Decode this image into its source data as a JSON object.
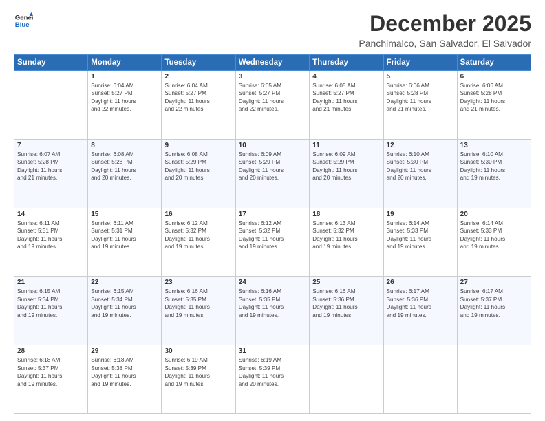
{
  "logo": {
    "line1": "General",
    "line2": "Blue"
  },
  "title": "December 2025",
  "subtitle": "Panchimalco, San Salvador, El Salvador",
  "weekdays": [
    "Sunday",
    "Monday",
    "Tuesday",
    "Wednesday",
    "Thursday",
    "Friday",
    "Saturday"
  ],
  "weeks": [
    [
      {
        "day": "",
        "info": ""
      },
      {
        "day": "1",
        "info": "Sunrise: 6:04 AM\nSunset: 5:27 PM\nDaylight: 11 hours\nand 22 minutes."
      },
      {
        "day": "2",
        "info": "Sunrise: 6:04 AM\nSunset: 5:27 PM\nDaylight: 11 hours\nand 22 minutes."
      },
      {
        "day": "3",
        "info": "Sunrise: 6:05 AM\nSunset: 5:27 PM\nDaylight: 11 hours\nand 22 minutes."
      },
      {
        "day": "4",
        "info": "Sunrise: 6:05 AM\nSunset: 5:27 PM\nDaylight: 11 hours\nand 21 minutes."
      },
      {
        "day": "5",
        "info": "Sunrise: 6:06 AM\nSunset: 5:28 PM\nDaylight: 11 hours\nand 21 minutes."
      },
      {
        "day": "6",
        "info": "Sunrise: 6:06 AM\nSunset: 5:28 PM\nDaylight: 11 hours\nand 21 minutes."
      }
    ],
    [
      {
        "day": "7",
        "info": "Sunrise: 6:07 AM\nSunset: 5:28 PM\nDaylight: 11 hours\nand 21 minutes."
      },
      {
        "day": "8",
        "info": "Sunrise: 6:08 AM\nSunset: 5:28 PM\nDaylight: 11 hours\nand 20 minutes."
      },
      {
        "day": "9",
        "info": "Sunrise: 6:08 AM\nSunset: 5:29 PM\nDaylight: 11 hours\nand 20 minutes."
      },
      {
        "day": "10",
        "info": "Sunrise: 6:09 AM\nSunset: 5:29 PM\nDaylight: 11 hours\nand 20 minutes."
      },
      {
        "day": "11",
        "info": "Sunrise: 6:09 AM\nSunset: 5:29 PM\nDaylight: 11 hours\nand 20 minutes."
      },
      {
        "day": "12",
        "info": "Sunrise: 6:10 AM\nSunset: 5:30 PM\nDaylight: 11 hours\nand 20 minutes."
      },
      {
        "day": "13",
        "info": "Sunrise: 6:10 AM\nSunset: 5:30 PM\nDaylight: 11 hours\nand 19 minutes."
      }
    ],
    [
      {
        "day": "14",
        "info": "Sunrise: 6:11 AM\nSunset: 5:31 PM\nDaylight: 11 hours\nand 19 minutes."
      },
      {
        "day": "15",
        "info": "Sunrise: 6:11 AM\nSunset: 5:31 PM\nDaylight: 11 hours\nand 19 minutes."
      },
      {
        "day": "16",
        "info": "Sunrise: 6:12 AM\nSunset: 5:32 PM\nDaylight: 11 hours\nand 19 minutes."
      },
      {
        "day": "17",
        "info": "Sunrise: 6:12 AM\nSunset: 5:32 PM\nDaylight: 11 hours\nand 19 minutes."
      },
      {
        "day": "18",
        "info": "Sunrise: 6:13 AM\nSunset: 5:32 PM\nDaylight: 11 hours\nand 19 minutes."
      },
      {
        "day": "19",
        "info": "Sunrise: 6:14 AM\nSunset: 5:33 PM\nDaylight: 11 hours\nand 19 minutes."
      },
      {
        "day": "20",
        "info": "Sunrise: 6:14 AM\nSunset: 5:33 PM\nDaylight: 11 hours\nand 19 minutes."
      }
    ],
    [
      {
        "day": "21",
        "info": "Sunrise: 6:15 AM\nSunset: 5:34 PM\nDaylight: 11 hours\nand 19 minutes."
      },
      {
        "day": "22",
        "info": "Sunrise: 6:15 AM\nSunset: 5:34 PM\nDaylight: 11 hours\nand 19 minutes."
      },
      {
        "day": "23",
        "info": "Sunrise: 6:16 AM\nSunset: 5:35 PM\nDaylight: 11 hours\nand 19 minutes."
      },
      {
        "day": "24",
        "info": "Sunrise: 6:16 AM\nSunset: 5:35 PM\nDaylight: 11 hours\nand 19 minutes."
      },
      {
        "day": "25",
        "info": "Sunrise: 6:16 AM\nSunset: 5:36 PM\nDaylight: 11 hours\nand 19 minutes."
      },
      {
        "day": "26",
        "info": "Sunrise: 6:17 AM\nSunset: 5:36 PM\nDaylight: 11 hours\nand 19 minutes."
      },
      {
        "day": "27",
        "info": "Sunrise: 6:17 AM\nSunset: 5:37 PM\nDaylight: 11 hours\nand 19 minutes."
      }
    ],
    [
      {
        "day": "28",
        "info": "Sunrise: 6:18 AM\nSunset: 5:37 PM\nDaylight: 11 hours\nand 19 minutes."
      },
      {
        "day": "29",
        "info": "Sunrise: 6:18 AM\nSunset: 5:38 PM\nDaylight: 11 hours\nand 19 minutes."
      },
      {
        "day": "30",
        "info": "Sunrise: 6:19 AM\nSunset: 5:39 PM\nDaylight: 11 hours\nand 19 minutes."
      },
      {
        "day": "31",
        "info": "Sunrise: 6:19 AM\nSunset: 5:39 PM\nDaylight: 11 hours\nand 20 minutes."
      },
      {
        "day": "",
        "info": ""
      },
      {
        "day": "",
        "info": ""
      },
      {
        "day": "",
        "info": ""
      }
    ]
  ]
}
